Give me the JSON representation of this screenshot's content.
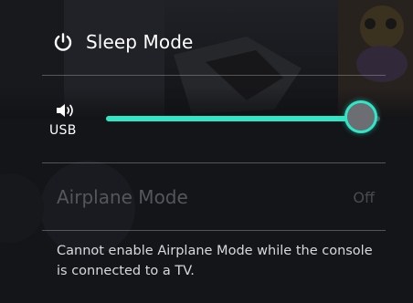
{
  "quick_settings": {
    "sleep": {
      "label": "Sleep Mode",
      "icon": "power-icon"
    },
    "volume": {
      "icon": "speaker-icon",
      "output_label": "USB",
      "level": 0.93,
      "accent_color": "#2fe6c6"
    },
    "airplane": {
      "label": "Airplane Mode",
      "value": "Off",
      "enabled": false
    },
    "notice": {
      "text": "Cannot enable Airplane Mode while the console is connected to a TV."
    }
  }
}
